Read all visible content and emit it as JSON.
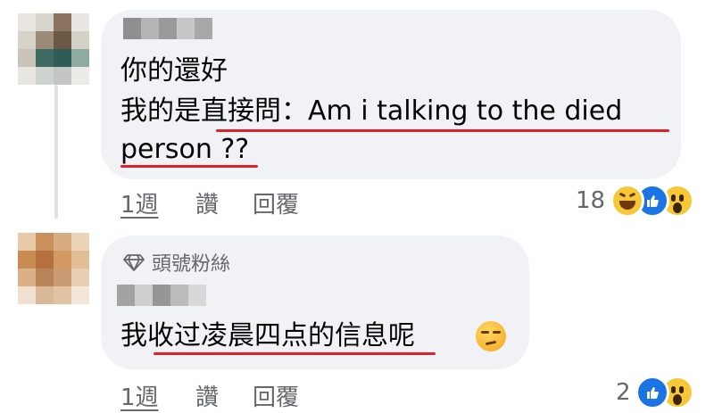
{
  "comments": [
    {
      "text_lines": [
        "你的還好",
        "我的是直接問：Am i talking to the died",
        "person ??"
      ],
      "time": "1週",
      "like": "讚",
      "reply": "回覆",
      "reaction_count": "18",
      "reactions": [
        "haha",
        "like",
        "wow"
      ]
    },
    {
      "badge": "頭號粉絲",
      "text": "我收过凌晨四点的信息呢",
      "text_emoji": "unamused-face",
      "time": "1週",
      "like": "讚",
      "reply": "回覆",
      "reaction_count": "2",
      "reactions": [
        "like",
        "wow"
      ]
    }
  ],
  "icons": {
    "badge": "diamond-icon"
  },
  "colors": {
    "bubble": "#f0f2f5",
    "underline": "#e0202b",
    "secondary_text": "#65676b",
    "like_blue": "#1b74e4",
    "reaction_yellow": "#f7c737"
  }
}
